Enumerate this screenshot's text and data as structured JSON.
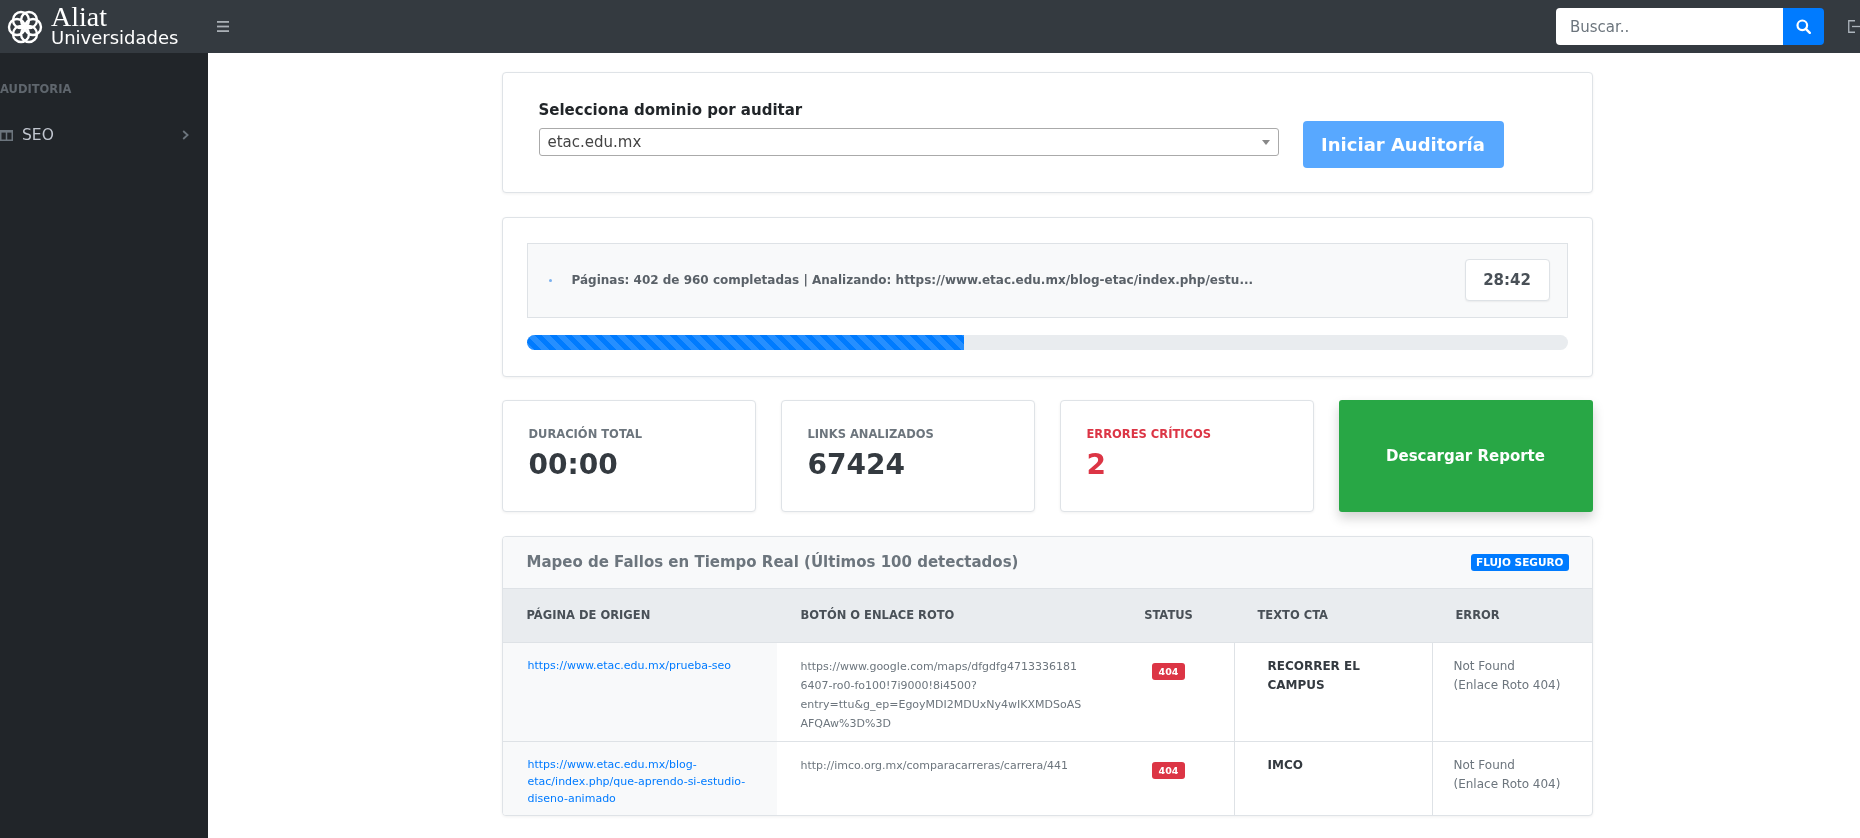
{
  "header": {
    "logo": {
      "title": "Aliat",
      "subtitle": "Universidades"
    },
    "search": {
      "placeholder": "Buscar.."
    }
  },
  "sidebar": {
    "section_label": "AUDITORIA",
    "items": [
      {
        "label": "SEO",
        "expanded": false
      }
    ]
  },
  "domain_form": {
    "label": "Selecciona dominio por auditar",
    "select_value": "etac.edu.mx",
    "start_button": {
      "label": "Iniciar Auditoría",
      "disabled": true
    }
  },
  "progress": {
    "status": "Páginas: 402 de 960 completadas | Analizando: https://www.etac.edu.mx/blog-etac/index.php/estu...",
    "timer": "28:42",
    "level": 0.42
  },
  "stats": [
    {
      "label": "DURACIÓN TOTAL",
      "value": "00:00",
      "kind": "neutral"
    },
    {
      "label": "LINKS ANALIZADOS",
      "value": "67424",
      "kind": "neutral"
    },
    {
      "label": "ERRORES CRÍTICOS",
      "value": "2",
      "kind": "danger"
    }
  ],
  "download_button": {
    "label": "Descargar Reporte"
  },
  "failures_table": {
    "title": "Mapeo de Fallos en Tiempo Real (Últimos 100 detectados)",
    "badge": "FLUJO SEGURO",
    "columns": [
      "PÁGINA DE ORIGEN",
      "BOTÓN O ENLACE ROTO",
      "STATUS",
      "TEXTO CTA",
      "ERROR"
    ],
    "rows": [
      {
        "source_page": "https://www.etac.edu.mx/prueba-seo",
        "broken_link": "https://www.google.com/maps/dfgdfg47133361816407-ro0-fo100!7i9000!8i4500?entry=ttu&g_ep=EgoyMDI2MDUxNy4wIKXMDSoASAFQAw%3D%3D",
        "status": "404",
        "cta_text": "RECORRER EL CAMPUS",
        "error": "Not Found",
        "error_detail": "(Enlace Roto 404)"
      },
      {
        "source_page": "https://www.etac.edu.mx/blog-etac/index.php/que-aprendo-si-estudio-diseno-animado",
        "broken_link": "http://imco.org.mx/comparacarreras/carrera/441",
        "status": "404",
        "cta_text": "IMCO",
        "error": "Not Found",
        "error_detail": "(Enlace Roto 404)"
      }
    ]
  }
}
